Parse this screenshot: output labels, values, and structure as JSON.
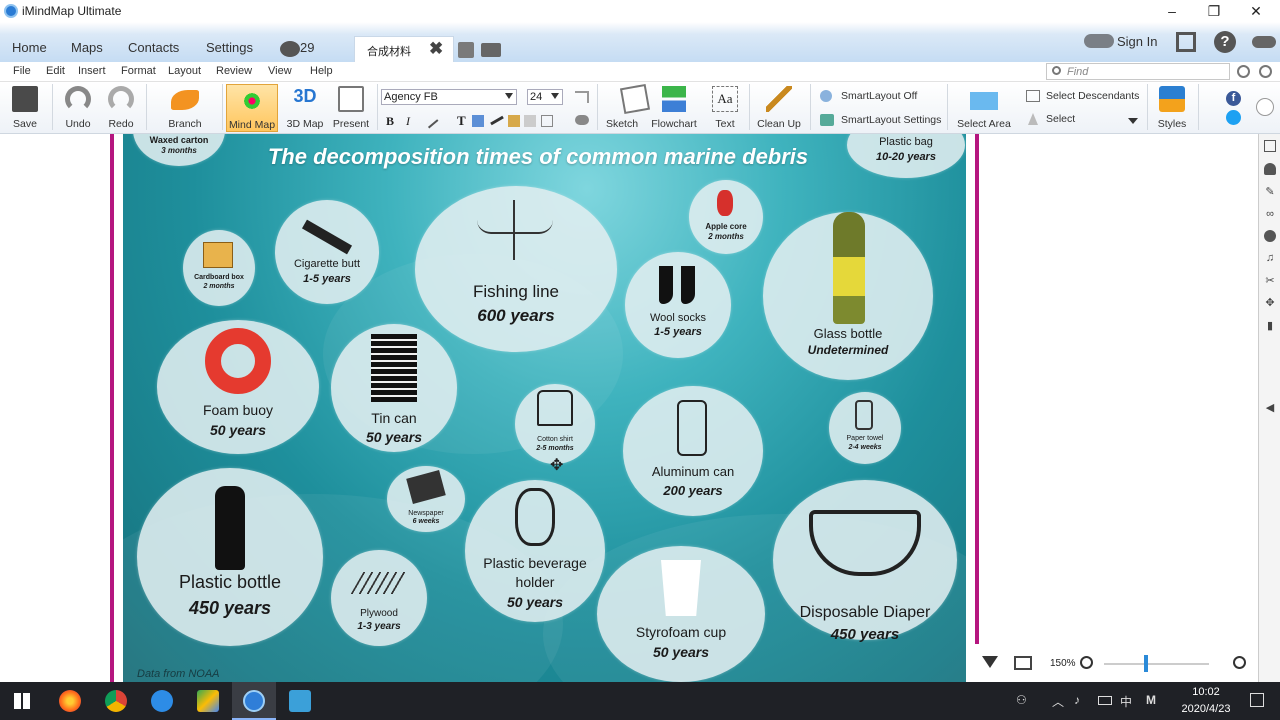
{
  "window": {
    "title": "iMindMap Ultimate",
    "minimize": "–",
    "restore": "❐",
    "close": "✕"
  },
  "nav": {
    "items": [
      "Home",
      "Maps",
      "Contacts",
      "Settings"
    ],
    "notifications": "29",
    "doc_tab": "合成材料",
    "doc_tab_close": "✖",
    "sign_in": "Sign In"
  },
  "menu": {
    "items": [
      "File",
      "Edit",
      "Insert",
      "Format",
      "Layout",
      "Review",
      "View",
      "Help"
    ],
    "find_placeholder": "Find"
  },
  "toolbar": {
    "save": "Save",
    "undo": "Undo",
    "redo": "Redo",
    "branch": "Branch",
    "mind_map": "Mind Map",
    "three_d": "3D Map",
    "present": "Present",
    "font": "Agency FB",
    "font_size": "24",
    "bold": "B",
    "italic": "I",
    "text_t": "T",
    "sketch": "Sketch",
    "flowchart": "Flowchart",
    "text": "Text",
    "clean_up": "Clean Up",
    "smartlayout_off": "SmartLayout Off",
    "smartlayout_settings": "SmartLayout Settings",
    "select_area": "Select Area",
    "select_descendants": "Select Descendants",
    "select": "Select",
    "styles": "Styles"
  },
  "poster": {
    "title": "The decomposition times of common marine debris",
    "credit": "Data from NOAA",
    "items": [
      {
        "name": "Waxed carton",
        "years": "3 months"
      },
      {
        "name": "Plastic bag",
        "years": "10-20 years"
      },
      {
        "name": "Cardboard box",
        "years": "2 months"
      },
      {
        "name": "Cigarette butt",
        "years": "1-5 years"
      },
      {
        "name": "Fishing line",
        "years": "600 years"
      },
      {
        "name": "Apple core",
        "years": "2 months"
      },
      {
        "name": "Wool socks",
        "years": "1-5 years"
      },
      {
        "name": "Glass bottle",
        "years": "Undetermined"
      },
      {
        "name": "Foam buoy",
        "years": "50 years"
      },
      {
        "name": "Tin can",
        "years": "50 years"
      },
      {
        "name": "Cotton shirt",
        "years": "2-5 months"
      },
      {
        "name": "Aluminum can",
        "years": "200 years"
      },
      {
        "name": "Paper towel",
        "years": "2-4 weeks"
      },
      {
        "name": "Newspaper",
        "years": "6 weeks"
      },
      {
        "name": "Plastic bottle",
        "years": "450 years"
      },
      {
        "name": "Plastic beverage holder",
        "years": "50 years"
      },
      {
        "name": "Plywood",
        "years": "1-3 years"
      },
      {
        "name": "Styrofoam cup",
        "years": "50 years"
      },
      {
        "name": "Disposable Diaper",
        "years": "450 years"
      }
    ]
  },
  "zoom": {
    "level": "150%"
  },
  "taskbar": {
    "time": "10:02",
    "date": "2020/4/23",
    "ime": "中",
    "ime2": "M"
  },
  "colors": {
    "accent": "#b5167f",
    "highlight": "#ffc65e",
    "taskbar": "#1f2126"
  }
}
